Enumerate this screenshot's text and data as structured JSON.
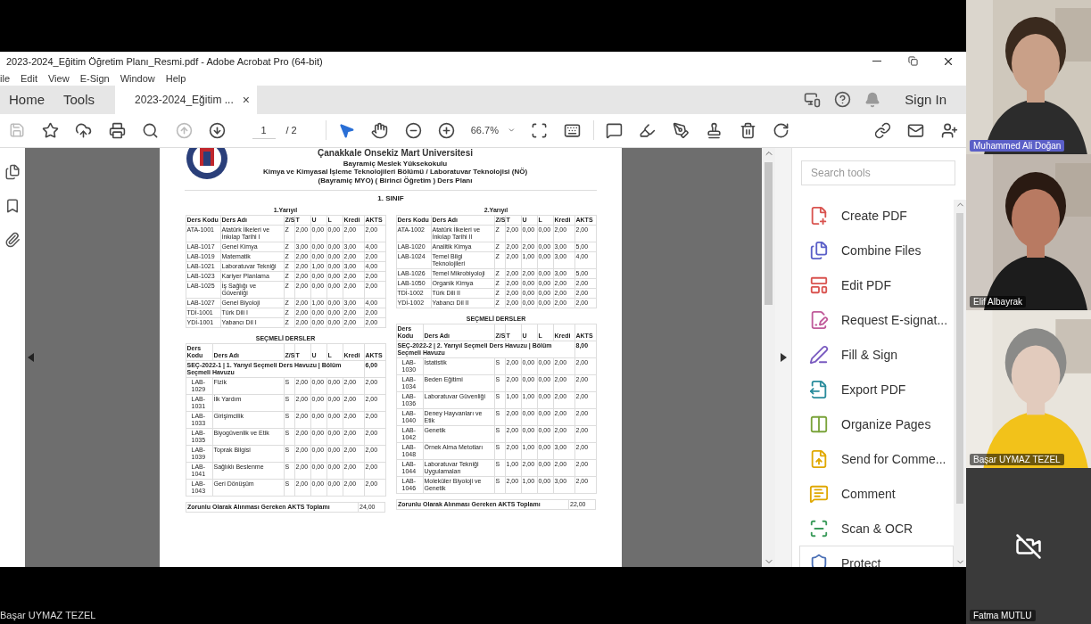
{
  "window": {
    "title": "2023-2024_Eğitim Öğretim Planı_Resmi.pdf - Adobe Acrobat Pro (64-bit)"
  },
  "menu": [
    "ile",
    "Edit",
    "View",
    "E-Sign",
    "Window",
    "Help"
  ],
  "tabs": [
    {
      "label": "Home",
      "selected": false
    },
    {
      "label": "Tools",
      "selected": false
    },
    {
      "label": "2023-2024_Eğitim ...",
      "selected": true,
      "close": "×"
    }
  ],
  "sign_in": "Sign In",
  "toolbar": {
    "page": "1",
    "page_total": "/ 2",
    "zoom": "66.7%"
  },
  "document": {
    "university": "Çanakkale Onsekiz Mart Üniversitesi",
    "school": "Bayramiç Meslek Yüksekokulu",
    "department": "Kimya ve Kimyasal İşleme Teknolojileri Bölümü / Laboratuvar Teknolojisi (NÖ) (Bayramiç MYO) ( Birinci Öğretim ) Ders Planı",
    "class_title": "1. SINIF",
    "semesters": [
      {
        "caption": "1.Yarıyıl",
        "columns": [
          "Ders Kodu",
          "Ders Adı",
          "Z/S",
          "T",
          "U",
          "L",
          "Kredi",
          "AKTS"
        ],
        "rows": [
          [
            "ATA-1001",
            "Atatürk İlkeleri ve İnkılap Tarihi I",
            "Z",
            "2,00",
            "0,00",
            "0,00",
            "2,00",
            "2,00"
          ],
          [
            "LAB-1017",
            "Genel Kimya",
            "Z",
            "3,00",
            "0,00",
            "0,00",
            "3,00",
            "4,00"
          ],
          [
            "LAB-1019",
            "Matematik",
            "Z",
            "2,00",
            "0,00",
            "0,00",
            "2,00",
            "2,00"
          ],
          [
            "LAB-1021",
            "Laboratuvar Tekniği",
            "Z",
            "2,00",
            "1,00",
            "0,00",
            "3,00",
            "4,00"
          ],
          [
            "LAB-1023",
            "Kariyer Planlama",
            "Z",
            "2,00",
            "0,00",
            "0,00",
            "2,00",
            "2,00"
          ],
          [
            "LAB-1025",
            "İş Sağlığı ve Güvenliği",
            "Z",
            "2,00",
            "0,00",
            "0,00",
            "2,00",
            "2,00"
          ],
          [
            "LAB-1027",
            "Genel Biyoloji",
            "Z",
            "2,00",
            "1,00",
            "0,00",
            "3,00",
            "4,00"
          ],
          [
            "TDİ-1001",
            "Türk Dili I",
            "Z",
            "2,00",
            "0,00",
            "0,00",
            "2,00",
            "2,00"
          ],
          [
            "YDİ-1001",
            "Yabancı Dil I",
            "Z",
            "2,00",
            "0,00",
            "0,00",
            "2,00",
            "2,00"
          ]
        ],
        "electives": {
          "title": "SEÇMELİ DERSLER",
          "columns": [
            "Ders Kodu",
            "Ders Adı",
            "Z/S",
            "T",
            "U",
            "L",
            "Kredi",
            "AKTS"
          ],
          "group": {
            "label": "SEÇ-2022-1 | 1. Yarıyıl Seçmeli Ders Havuzu | Bölüm Seçmeli Havuzu",
            "akts": "6,00"
          },
          "rows": [
            [
              "LAB-1029",
              "Fizik",
              "S",
              "2,00",
              "0,00",
              "0,00",
              "2,00",
              "2,00"
            ],
            [
              "LAB-1031",
              "İlk Yardım",
              "S",
              "2,00",
              "0,00",
              "0,00",
              "2,00",
              "2,00"
            ],
            [
              "LAB-1033",
              "Girişimcilik",
              "S",
              "2,00",
              "0,00",
              "0,00",
              "2,00",
              "2,00"
            ],
            [
              "LAB-1035",
              "Biyogüvenlik ve Etik",
              "S",
              "2,00",
              "0,00",
              "0,00",
              "2,00",
              "2,00"
            ],
            [
              "LAB-1039",
              "Toprak Bilgisi",
              "S",
              "2,00",
              "0,00",
              "0,00",
              "2,00",
              "2,00"
            ],
            [
              "LAB-1041",
              "Sağlıklı Beslenme",
              "S",
              "2,00",
              "0,00",
              "0,00",
              "2,00",
              "2,00"
            ],
            [
              "LAB-1043",
              "Geri Dönüşüm",
              "S",
              "2,00",
              "0,00",
              "0,00",
              "2,00",
              "2,00"
            ]
          ]
        },
        "total": {
          "label": "Zorunlu Olarak Alınması Gereken AKTS Toplamı",
          "value": "24,00"
        }
      },
      {
        "caption": "2.Yarıyıl",
        "columns": [
          "Ders Kodu",
          "Ders Adı",
          "Z/S",
          "T",
          "U",
          "L",
          "Kredi",
          "AKTS"
        ],
        "rows": [
          [
            "ATA-1002",
            "Atatürk İlkeleri ve İnkılap Tarihi II",
            "Z",
            "2,00",
            "0,00",
            "0,00",
            "2,00",
            "2,00"
          ],
          [
            "LAB-1020",
            "Analitik Kimya",
            "Z",
            "2,00",
            "2,00",
            "0,00",
            "3,00",
            "5,00"
          ],
          [
            "LAB-1024",
            "Temel Bilgi Teknolojileri",
            "Z",
            "2,00",
            "1,00",
            "0,00",
            "3,00",
            "4,00"
          ],
          [
            "LAB-1026",
            "Temel Mikrobiyoloji",
            "Z",
            "2,00",
            "2,00",
            "0,00",
            "3,00",
            "5,00"
          ],
          [
            "LAB-1050",
            "Organik Kimya",
            "Z",
            "2,00",
            "0,00",
            "0,00",
            "2,00",
            "2,00"
          ],
          [
            "TDİ-1002",
            "Türk Dili II",
            "Z",
            "2,00",
            "0,00",
            "0,00",
            "2,00",
            "2,00"
          ],
          [
            "YDİ-1002",
            "Yabancı Dil II",
            "Z",
            "2,00",
            "0,00",
            "0,00",
            "2,00",
            "2,00"
          ]
        ],
        "electives": {
          "title": "SEÇMELİ DERSLER",
          "columns": [
            "Ders Kodu",
            "Ders Adı",
            "Z/S",
            "T",
            "U",
            "L",
            "Kredi",
            "AKTS"
          ],
          "group": {
            "label": "SEÇ-2022-2 | 2. Yarıyıl Seçmeli Ders Havuzu | Bölüm Seçmeli Havuzu",
            "akts": "8,00"
          },
          "rows": [
            [
              "LAB-1030",
              "İstatistik",
              "S",
              "2,00",
              "0,00",
              "0,00",
              "2,00",
              "2,00"
            ],
            [
              "LAB-1034",
              "Beden Eğitimi",
              "S",
              "2,00",
              "0,00",
              "0,00",
              "2,00",
              "2,00"
            ],
            [
              "LAB-1036",
              "Laboratuvar Güvenliği",
              "S",
              "1,00",
              "1,00",
              "0,00",
              "2,00",
              "2,00"
            ],
            [
              "LAB-1040",
              "Deney Hayvanları ve Etik",
              "S",
              "2,00",
              "0,00",
              "0,00",
              "2,00",
              "2,00"
            ],
            [
              "LAB-1042",
              "Genetik",
              "S",
              "2,00",
              "0,00",
              "0,00",
              "2,00",
              "2,00"
            ],
            [
              "LAB-1048",
              "Örnek Alma Metotları",
              "S",
              "2,00",
              "1,00",
              "0,00",
              "3,00",
              "2,00"
            ],
            [
              "LAB-1044",
              "Laboratuvar Tekniği Uygulamaları",
              "S",
              "1,00",
              "2,00",
              "0,00",
              "2,00",
              "2,00"
            ],
            [
              "LAB-1046",
              "Moleküler Biyoloji ve Genetik",
              "S",
              "2,00",
              "1,00",
              "0,00",
              "3,00",
              "2,00"
            ]
          ]
        },
        "total": {
          "label": "Zorunlu Olarak Alınması Gereken AKTS Toplamı",
          "value": "22,00"
        }
      }
    ]
  },
  "tools_pane": {
    "search_placeholder": "Search tools",
    "tools": [
      {
        "label": "Create PDF",
        "highlighted": false
      },
      {
        "label": "Combine Files",
        "highlighted": false
      },
      {
        "label": "Edit PDF",
        "highlighted": false
      },
      {
        "label": "Request E-signat...",
        "highlighted": false
      },
      {
        "label": "Fill & Sign",
        "highlighted": false
      },
      {
        "label": "Export PDF",
        "highlighted": false
      },
      {
        "label": "Organize Pages",
        "highlighted": false
      },
      {
        "label": "Send for Comme...",
        "highlighted": false
      },
      {
        "label": "Comment",
        "highlighted": false
      },
      {
        "label": "Scan & OCR",
        "highlighted": false
      },
      {
        "label": "Protect",
        "highlighted": true
      }
    ]
  },
  "participants": [
    {
      "name": "Muhammed Ali Doğan",
      "kind": "video",
      "speaking": true
    },
    {
      "name": "Elif Albayrak",
      "kind": "video",
      "speaking": false
    },
    {
      "name": "Başar UYMAZ TEZEL",
      "kind": "video",
      "speaking": false
    },
    {
      "name": "Fatma  MUTLU",
      "kind": "camera_off",
      "speaking": false
    }
  ],
  "presenter_caption": "Başar UYMAZ TEZEL"
}
